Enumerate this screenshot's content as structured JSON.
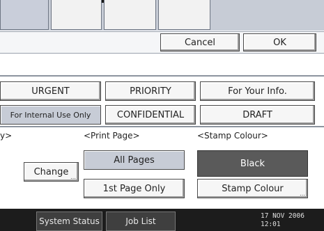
{
  "header": {
    "cancel_label": "Cancel",
    "ok_label": "OK"
  },
  "stamps": {
    "row1": [
      "URGENT",
      "PRIORITY",
      "For Your Info."
    ],
    "row2": [
      "For Internal Use Only",
      "CONFIDENTIAL",
      "DRAFT"
    ]
  },
  "settings": {
    "left_label_partial": "y>",
    "change_label": "Change",
    "print_page_label": "<Print Page>",
    "all_pages_label": "All Pages",
    "first_page_label": "1st Page Only",
    "stamp_colour_label": "<Stamp Colour>",
    "colour_value": "Black",
    "stamp_colour_button": "Stamp Colour"
  },
  "footer": {
    "system_status_label": "System Status",
    "job_list_label": "Job List",
    "date": "17 NOV  2006",
    "time": "12:01"
  },
  "colors": {
    "selected_bg": "#c7ccd6",
    "dark_button": "#5a5a5a",
    "bottom_bar": "#1c1c1c"
  }
}
